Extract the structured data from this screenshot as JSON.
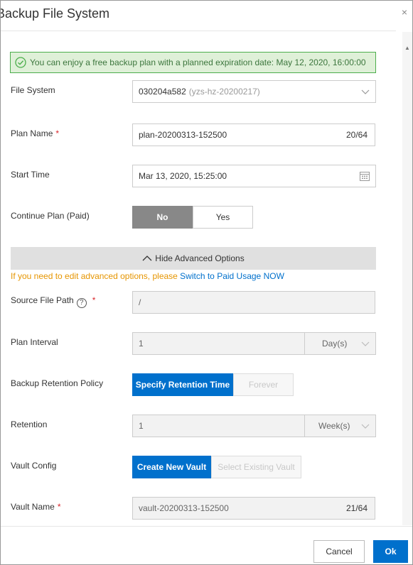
{
  "dialog": {
    "title": "Backup File System",
    "close_glyph": "×"
  },
  "notice": {
    "text": "You can enjoy a free backup plan with a planned expiration date: May 12, 2020, 16:00:00"
  },
  "form": {
    "file_system": {
      "label": "File System",
      "value": "030204a582",
      "hint": "(yzs-hz-20200217)"
    },
    "plan_name": {
      "label": "Plan Name",
      "value": "plan-20200313-152500",
      "count": "20/64"
    },
    "start_time": {
      "label": "Start Time",
      "value": "Mar 13, 2020, 15:25:00"
    },
    "continue_plan": {
      "label": "Continue Plan (Paid)",
      "options": [
        "No",
        "Yes"
      ],
      "selected": "No"
    },
    "advanced": {
      "toggle_label": "Hide Advanced Options",
      "tip_prefix": "If you need to edit advanced options, please ",
      "tip_link": "Switch to Paid Usage NOW"
    },
    "source_path": {
      "label": "Source File Path",
      "value": "/"
    },
    "plan_interval": {
      "label": "Plan Interval",
      "value": "1",
      "unit": "Day(s)"
    },
    "retention_policy": {
      "label": "Backup Retention Policy",
      "options": [
        "Specify Retention Time",
        "Forever"
      ],
      "selected": "Specify Retention Time"
    },
    "retention": {
      "label": "Retention",
      "value": "1",
      "unit": "Week(s)"
    },
    "vault_config": {
      "label": "Vault Config",
      "options": [
        "Create New Vault",
        "Select Existing Vault"
      ],
      "selected": "Create New Vault"
    },
    "vault_name": {
      "label": "Vault Name",
      "value": "vault-20200313-152500",
      "count": "21/64"
    },
    "required_mark": "*",
    "help_glyph": "?"
  },
  "footer": {
    "cancel_label": "Cancel",
    "ok_label": "Ok"
  },
  "colors": {
    "primary": "#0070cc",
    "success_bg": "#dff0d8",
    "success_border": "#4cae4c",
    "warning_text": "#e69500",
    "required": "#d9262c"
  }
}
